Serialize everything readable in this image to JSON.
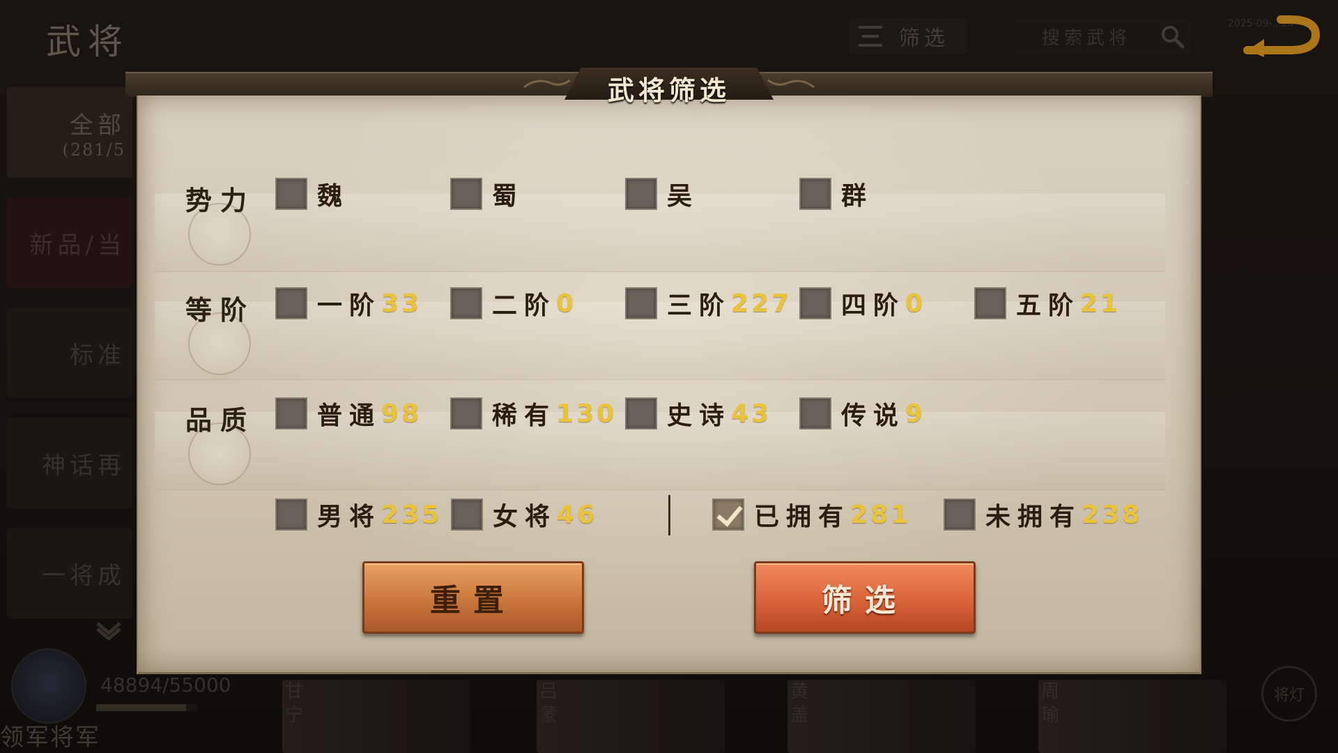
{
  "screen": {
    "title": "武将",
    "top_filter_label": "筛选",
    "search_placeholder": "搜索武将",
    "corner_time": "2025-09-...20"
  },
  "side_tabs": [
    {
      "label": "全部",
      "sub": "(281/5"
    },
    {
      "label": "新品/当",
      "sub": ""
    },
    {
      "label": "标准",
      "sub": ""
    },
    {
      "label": "神话再",
      "sub": ""
    },
    {
      "label": "一将成",
      "sub": ""
    }
  ],
  "player": {
    "exp_text": "48894/55000",
    "exp_progress": 0.89,
    "rank_title": "领军将军"
  },
  "hero_cards": [
    {
      "name": "甘宁"
    },
    {
      "name": "吕蒙"
    },
    {
      "name": "黄盖"
    },
    {
      "name": "周瑜"
    }
  ],
  "generals_button_label": "将灯",
  "modal": {
    "title": "武将筛选",
    "rows": {
      "faction": {
        "label": "势力",
        "options": [
          {
            "label": "魏",
            "count": "",
            "checked": false
          },
          {
            "label": "蜀",
            "count": "",
            "checked": false
          },
          {
            "label": "吴",
            "count": "",
            "checked": false
          },
          {
            "label": "群",
            "count": "",
            "checked": false
          }
        ]
      },
      "rank": {
        "label": "等阶",
        "options": [
          {
            "label": "一阶",
            "count": "33",
            "checked": false
          },
          {
            "label": "二阶",
            "count": "0",
            "checked": false
          },
          {
            "label": "三阶",
            "count": "227",
            "checked": false
          },
          {
            "label": "四阶",
            "count": "0",
            "checked": false
          },
          {
            "label": "五阶",
            "count": "21",
            "checked": false
          }
        ]
      },
      "quality": {
        "label": "品质",
        "options": [
          {
            "label": "普通",
            "count": "98",
            "checked": false
          },
          {
            "label": "稀有",
            "count": "130",
            "checked": false
          },
          {
            "label": "史诗",
            "count": "43",
            "checked": false
          },
          {
            "label": "传说",
            "count": "9",
            "checked": false
          }
        ]
      },
      "misc": {
        "options": [
          {
            "label": "男将",
            "count": "235",
            "checked": false
          },
          {
            "label": "女将",
            "count": "46",
            "checked": false
          },
          {
            "label": "已拥有",
            "count": "281",
            "checked": true
          },
          {
            "label": "未拥有",
            "count": "238",
            "checked": false
          }
        ]
      }
    },
    "reset_label": "重置",
    "apply_label": "筛选"
  },
  "colors": {
    "count_yellow": "#e8c33b",
    "apply_button": "#d9643a",
    "reset_button": "#c9773b"
  }
}
